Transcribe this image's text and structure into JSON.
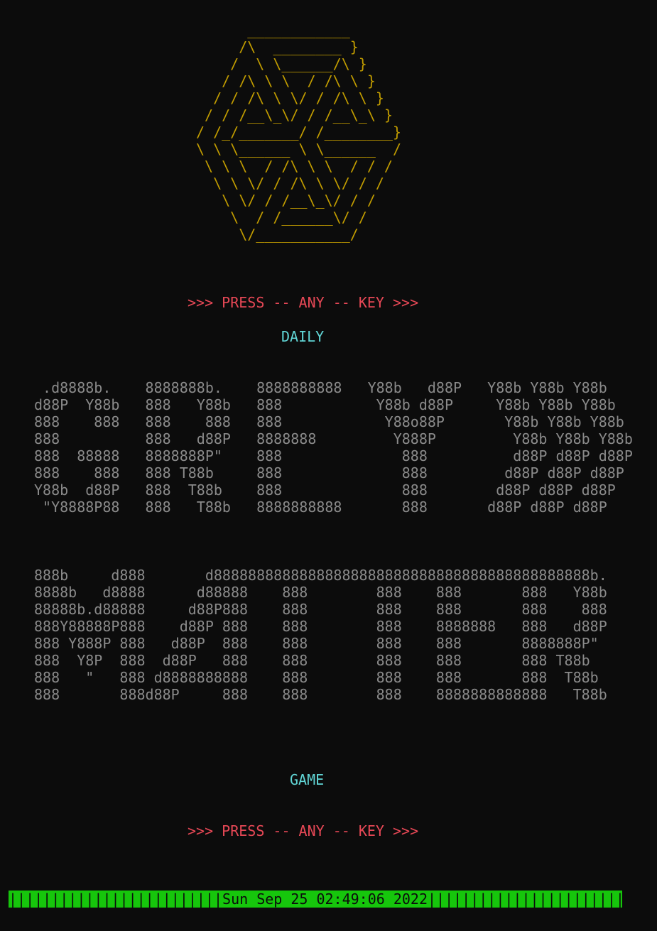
{
  "terminal": {
    "logo_art": "      ____________\n     /\\  ________ }\n    /  \\ \\______/\\ }\n   / /\\ \\ \\  / /\\ \\ }\n  / / /\\ \\ \\/ / /\\ \\ }\n / / /__\\_\\/ / /__\\_\\ }\n/ /_/_______/ /________}\n\\ \\ \\______ \\ \\______  /\n \\ \\ \\  / /\\ \\ \\  / / /\n  \\ \\ \\/ / /\\ \\ \\/ / /\n   \\ \\/ / /__\\_\\/ / /\n    \\  / /______\\/ /\n     \\/___________/",
    "press_top": ">>> PRESS -- ANY -- KEY >>>",
    "label_daily": "DAILY",
    "art_block_1": " .d8888b.    8888888b.    8888888888   Y88b   d88P   Y88b Y88b Y88b\nd88P  Y88b   888   Y88b   888           Y88b d88P     Y88b Y88b Y88b\n888    888   888    888   888            Y88o88P       Y88b Y88b Y88b\n888          888   d88P   8888888         Y888P         Y88b Y88b Y88b\n888  88888   8888888P\"    888              888          d88P d88P d88P\n888    888   888 T88b     888              888         d88P d88P d88P\nY88b  d88P   888  T88b    888              888        d88P d88P d88P\n \"Y8888P88   888   T88b   8888888888       888       d88P d88P d88P",
    "art_block_2": "888b     d888       d88888888888888888888888888888888888888888888b.\n8888b   d8888      d88888    888        888    888       888   Y88b\n88888b.d88888     d88P888    888        888    888       888    888\n888Y88888P888    d88P 888    888        888    8888888   888   d88P\n888 Y888P 888   d88P  888    888        888    888       8888888P\"\n888  Y8P  888  d88P   888    888        888    888       888 T88b\n888   \"   888 d8888888888    888        888    888       888  T88b\n888       888d88P     888    888        888    8888888888888   T88b",
    "label_game": "GAME",
    "press_bottom": ">>> PRESS -- ANY -- KEY >>>",
    "status_bar": "|||||||||||||||||||||||||Sun Sep 25 02:49:06 2022||||||||||||||||||||||||",
    "colors": {
      "background": "#0c0c0c",
      "logo": "#c19c00",
      "press_text": "#e74856",
      "label_text": "#61d6d6",
      "ascii_art": "#8a8a8a",
      "status_bar_bg": "#16c60c"
    }
  }
}
